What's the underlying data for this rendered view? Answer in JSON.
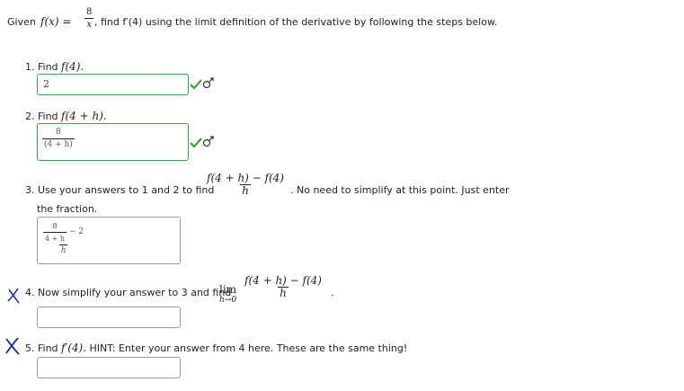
{
  "intro": {
    "given": "Given",
    "f_of_x": "f(x) =",
    "frac_num": "8",
    "frac_den": "x",
    "text": ", find f′(4) using the limit definition of the derivative by following the steps below."
  },
  "q1": {
    "label": "1. Find",
    "math": "f(4).",
    "answer": "2"
  },
  "q2": {
    "label": "2. Find",
    "math": "f(4 + h).",
    "answer_num": "8",
    "answer_den": "(4 + h)"
  },
  "q3": {
    "label": "3. Use your answers to 1 and 2 to find",
    "frac_num": "f(4 + h) − f(4)",
    "frac_den": "h",
    "text_after": ". No need to simplify at this point. Just enter",
    "text_line2": "the fraction.",
    "answer_inner_num": "8",
    "answer_inner_den": "4 + h",
    "answer_minus": "− 2",
    "answer_den": "h"
  },
  "q4": {
    "label": "4. Now simplify your answer to 3 and find",
    "lim": "lim",
    "lim_sub": "h→0",
    "frac_num": "f(4 + h) − f(4)",
    "frac_den": "h",
    "period": ".",
    "answer": ""
  },
  "q5": {
    "label": "5. Find",
    "math": "f′(4).",
    "text": "HINT: Enter your answer from 4 here. These are the same thing!",
    "answer": ""
  },
  "colors": {
    "correct_border": "#3aa53a",
    "check": "#2e9a2e",
    "xmark": "#1a2a8a",
    "box_border": "#999999"
  }
}
